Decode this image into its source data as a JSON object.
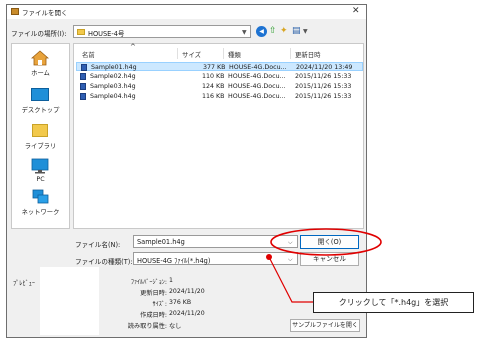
{
  "dialog": {
    "title": "ファイルを開く",
    "close_glyph": "✕"
  },
  "location": {
    "label": "ファイルの場所(I):",
    "value": "HOUSE-4号"
  },
  "toolbar": {
    "back_glyph": "◀",
    "up_glyph": "⇧",
    "new_folder_glyph": "✦",
    "view_glyph": "▤"
  },
  "sidebar": {
    "items": [
      {
        "label": "ホーム",
        "icon": "home-icon"
      },
      {
        "label": "デスクトップ",
        "icon": "desktop-icon"
      },
      {
        "label": "ライブラリ",
        "icon": "library-icon"
      },
      {
        "label": "PC",
        "icon": "pc-icon"
      },
      {
        "label": "ネットワーク",
        "icon": "network-icon"
      }
    ]
  },
  "file_list": {
    "sort_glyph": "^",
    "columns": [
      "名前",
      "サイズ",
      "種類",
      "更新日時"
    ],
    "rows": [
      {
        "name": "Sample01.h4g",
        "size": "377 KB",
        "type": "HOUSE-4G.Docu...",
        "date": "2024/11/20 13:49",
        "selected": true
      },
      {
        "name": "Sample02.h4g",
        "size": "110 KB",
        "type": "HOUSE-4G.Docu...",
        "date": "2015/11/26 15:33",
        "selected": false
      },
      {
        "name": "Sample03.h4g",
        "size": "124 KB",
        "type": "HOUSE-4G.Docu...",
        "date": "2015/11/26 15:33",
        "selected": false
      },
      {
        "name": "Sample04.h4g",
        "size": "116 KB",
        "type": "HOUSE-4G.Docu...",
        "date": "2015/11/26 15:33",
        "selected": false
      }
    ]
  },
  "filename": {
    "label": "ファイル名(N):",
    "value": "Sample01.h4g"
  },
  "filetype": {
    "label": "ファイルの種類(T):",
    "value": "HOUSE-4G ﾌｧｲﾙ(*.h4g)"
  },
  "buttons": {
    "open": "開く(O)",
    "cancel": "キャンセル",
    "sample": "サンプルファイルを開く"
  },
  "preview": {
    "label": "ﾌﾟﾚﾋﾞｭｰ"
  },
  "info": [
    {
      "label": "ﾌｧｲﾙﾊﾞｰｼﾞｮﾝ:",
      "value": "1"
    },
    {
      "label": "更新日時:",
      "value": "2024/11/20"
    },
    {
      "label": "ｻｲｽﾞ:",
      "value": "376 KB"
    },
    {
      "label": "作成日時:",
      "value": "2024/11/20"
    },
    {
      "label": "読み取り属性:",
      "value": "なし"
    }
  ],
  "annotation": {
    "callout_text": "クリックして「*.h4g」を選択",
    "color": "#e00000"
  }
}
